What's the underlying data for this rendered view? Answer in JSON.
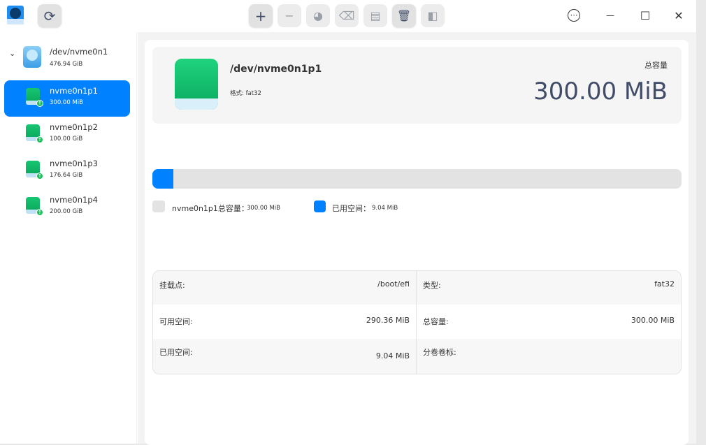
{
  "toolbar": {
    "refresh": "refresh",
    "buttons": [
      "add-partition",
      "delete-partition",
      "resize-partition",
      "wipe",
      "mount",
      "unmount",
      "split"
    ]
  },
  "window_controls": {
    "menu": "⋯",
    "minimize": "—",
    "maximize": "☐",
    "close": "✕"
  },
  "sidebar": {
    "disk": {
      "name": "/dev/nvme0n1",
      "size": "476.94 GiB"
    },
    "partitions": [
      {
        "name": "nvme0n1p1",
        "size": "300.00 MiB",
        "selected": true
      },
      {
        "name": "nvme0n1p2",
        "size": "100.00 GiB"
      },
      {
        "name": "nvme0n1p3",
        "size": "176.64 GiB"
      },
      {
        "name": "nvme0n1p4",
        "size": "200.00 GiB"
      }
    ]
  },
  "header": {
    "title": "/dev/nvme0n1p1",
    "format": "格式: fat32",
    "capacity_label": "总容量",
    "capacity": "300.00 MiB"
  },
  "usage": {
    "used_fraction": 0.0301,
    "total_label": "nvme0n1p1总容量：",
    "total": "300.00 MiB",
    "used_label": "已用空间：",
    "used": "9.04 MiB",
    "used_color": "#0081ff",
    "free_color": "#e3e3e3"
  },
  "details": {
    "mount_label": "挂载点:",
    "mount": "/boot/efi",
    "type_label": "类型:",
    "type": "fat32",
    "free_label": "可用空间:",
    "free": "290.36 MiB",
    "total_label": "总容量:",
    "total": "300.00 MiB",
    "used_label": "已用空间:",
    "used": "9.04 MiB",
    "vol_label": "分卷卷标:",
    "vol": ""
  }
}
